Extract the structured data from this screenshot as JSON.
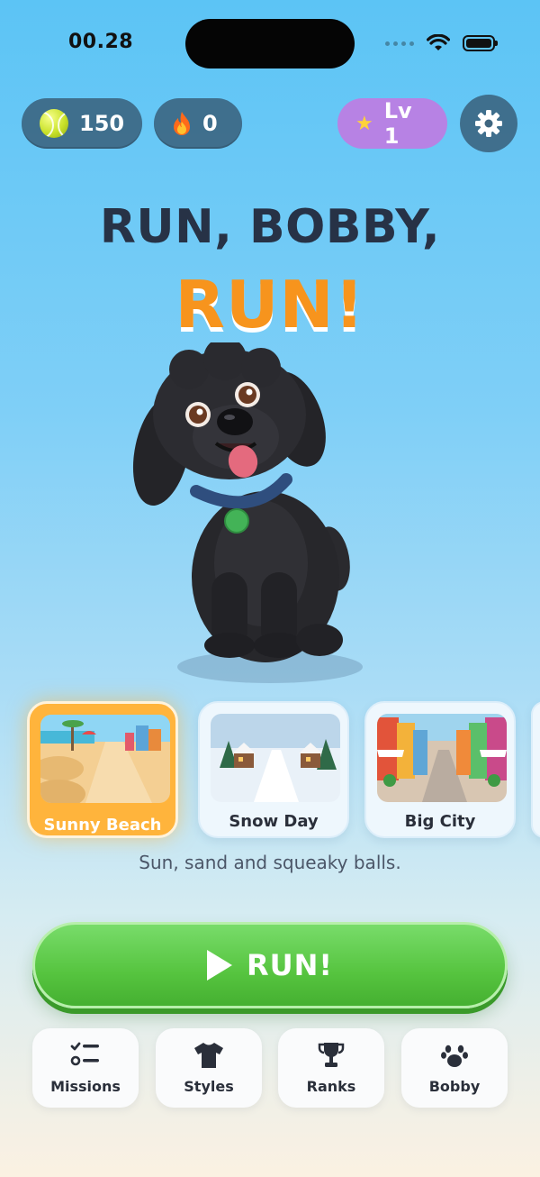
{
  "status_bar": {
    "time": "00.28"
  },
  "header": {
    "coins": "150",
    "streak": "0",
    "level": "Lv 1",
    "icons": {
      "coins": "tennis-ball-icon",
      "streak": "fire-icon",
      "level": "star-icon",
      "settings": "gear-icon"
    }
  },
  "title": {
    "line1": "RUN, BOBBY,",
    "line2": "RUN!"
  },
  "worlds": [
    {
      "label": "Sunny Beach",
      "selected": true
    },
    {
      "label": "Snow Day",
      "selected": false
    },
    {
      "label": "Big City",
      "selected": false
    }
  ],
  "tagline": "Sun, sand and squeaky balls.",
  "run_button": {
    "label": "RUN!",
    "icon": "play-icon"
  },
  "nav": [
    {
      "label": "Missions",
      "icon": "checklist-icon"
    },
    {
      "label": "Styles",
      "icon": "tshirt-icon"
    },
    {
      "label": "Ranks",
      "icon": "trophy-icon"
    },
    {
      "label": "Bobby",
      "icon": "paw-icon"
    }
  ],
  "colors": {
    "accent_orange": "#f7941d",
    "title_dark": "#273246",
    "run_green": "#56c43f",
    "level_purple": "#b782e4",
    "selected_card": "#ffb43c"
  }
}
